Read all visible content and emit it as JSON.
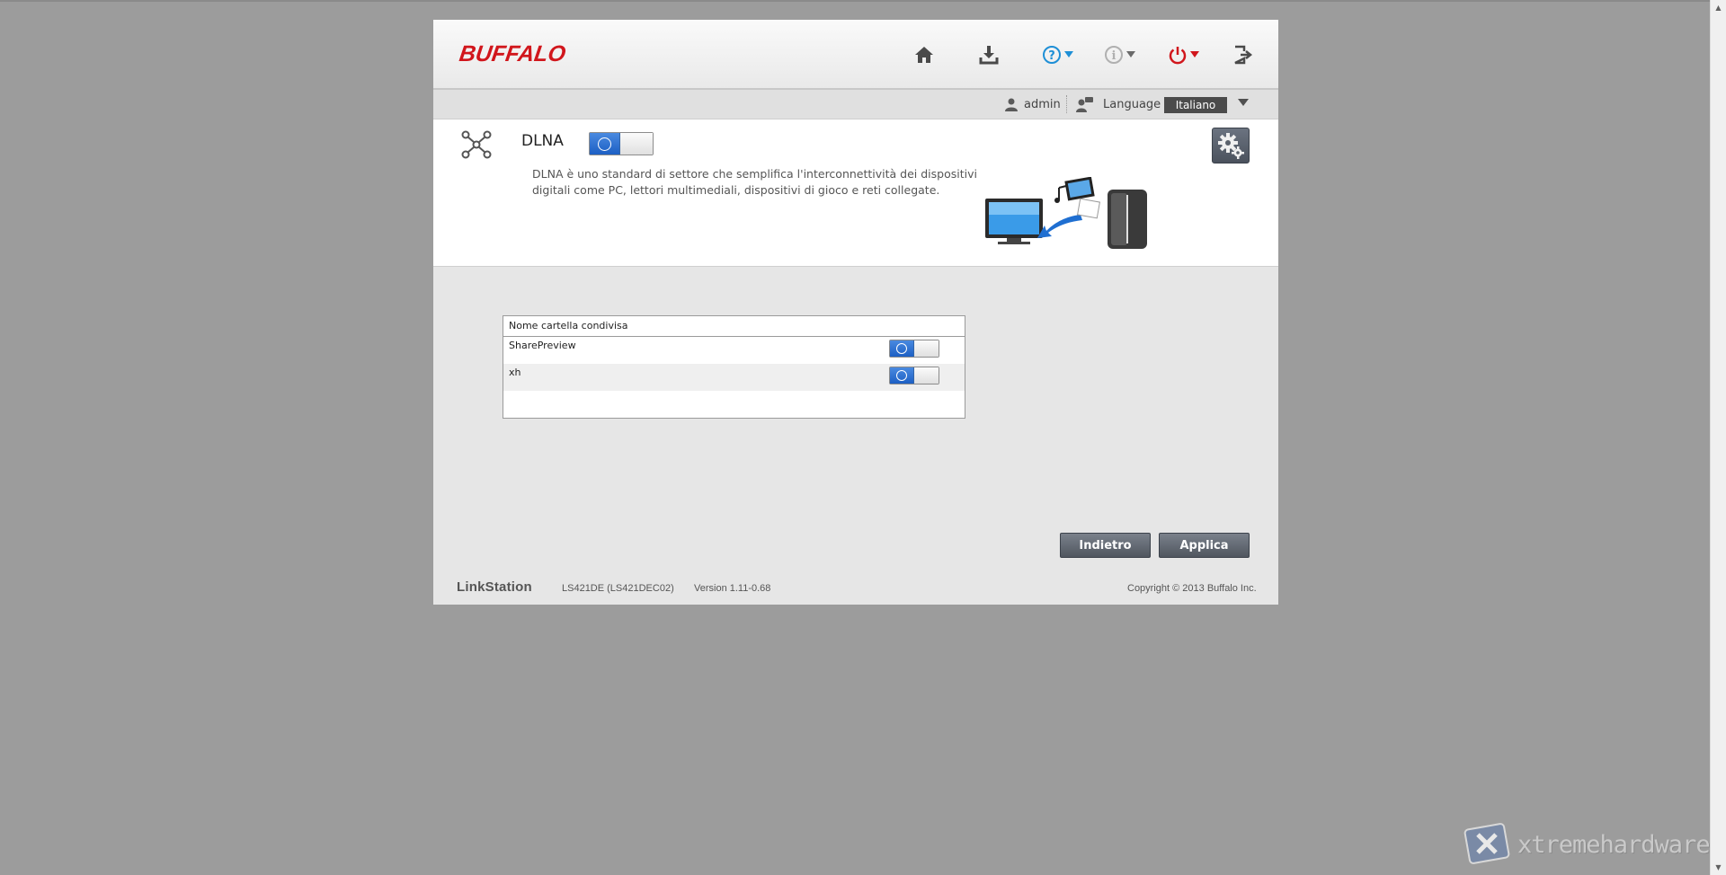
{
  "header": {
    "brand": "BUFFALO",
    "icons": {
      "home": "home-icon",
      "download": "download-icon",
      "help": "help-icon",
      "info": "info-icon",
      "power": "power-icon",
      "logout": "logout-icon"
    },
    "colors": {
      "brand": "#d1161c",
      "help": "#1e8fd6",
      "power": "#d1161c",
      "accent": "#1c5fc4"
    }
  },
  "userbar": {
    "user": "admin",
    "language_label": "Language",
    "language_value": "Italiano"
  },
  "dlna": {
    "title": "DLNA",
    "enabled": true,
    "description": "DLNA è uno standard di settore che semplifica l'interconnettività dei dispositivi digitali come PC, lettori multimediali, dispositivi di gioco e reti collegate."
  },
  "shares_table": {
    "header": "Nome cartella condivisa",
    "rows": [
      {
        "name": "SharePreview",
        "enabled": true
      },
      {
        "name": "xh",
        "enabled": true
      }
    ]
  },
  "buttons": {
    "back": "Indietro",
    "apply": "Applica"
  },
  "footer": {
    "product": "LinkStation",
    "model": "LS421DE (LS421DEC02)",
    "version": "Version 1.11-0.68",
    "copyright": "Copyright © 2013 Buffalo Inc."
  },
  "watermark": "xtremehardware.com"
}
